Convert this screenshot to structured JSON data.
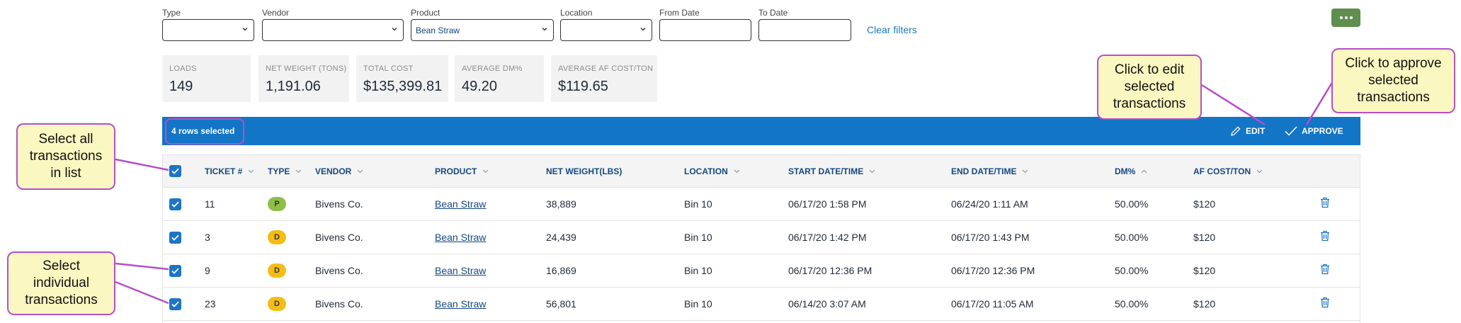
{
  "filters": {
    "type_label": "Type",
    "type_value": "",
    "vendor_label": "Vendor",
    "vendor_value": "",
    "product_label": "Product",
    "product_value": "Bean Straw",
    "location_label": "Location",
    "location_value": "",
    "from_date_label": "From Date",
    "from_date_value": "",
    "to_date_label": "To Date",
    "to_date_value": "",
    "clear_label": "Clear filters"
  },
  "more_button": {
    "icon": "more-dots-icon"
  },
  "stats": [
    {
      "label": "LOADS",
      "value": "149"
    },
    {
      "label": "NET WEIGHT (TONS)",
      "value": "1,191.06"
    },
    {
      "label": "TOTAL COST",
      "value": "$135,399.81"
    },
    {
      "label": "AVERAGE DM%",
      "value": "49.20"
    },
    {
      "label": "AVERAGE AF COST/TON",
      "value": "$119.65"
    }
  ],
  "selection_bar": {
    "count_text": "4 rows selected",
    "edit_label": "EDIT",
    "approve_label": "APPROVE",
    "color": "#1375c6"
  },
  "table": {
    "columns": [
      {
        "label": "TICKET #",
        "sort": "none"
      },
      {
        "label": "TYPE",
        "sort": "none"
      },
      {
        "label": "VENDOR",
        "sort": "none"
      },
      {
        "label": "PRODUCT",
        "sort": "none"
      },
      {
        "label": "NET WEIGHT(LBS)",
        "sort": "none"
      },
      {
        "label": "LOCATION",
        "sort": "none"
      },
      {
        "label": "START DATE/TIME",
        "sort": "none"
      },
      {
        "label": "END DATE/TIME",
        "sort": "none"
      },
      {
        "label": "DM%",
        "sort": "ascending"
      },
      {
        "label": "AF COST/TON",
        "sort": "none"
      }
    ],
    "rows": [
      {
        "ticket": "11",
        "type": "P",
        "vendor": "Bivens Co.",
        "product": "Bean Straw",
        "net_weight": "38,889",
        "location": "Bin 10",
        "start": "06/17/20 1:58 PM",
        "end": "06/24/20 1:11 AM",
        "dm": "50.00%",
        "af_cost": "$120",
        "selected": true
      },
      {
        "ticket": "3",
        "type": "D",
        "vendor": "Bivens Co.",
        "product": "Bean Straw",
        "net_weight": "24,439",
        "location": "Bin 10",
        "start": "06/17/20 1:42 PM",
        "end": "06/17/20 1:43 PM",
        "dm": "50.00%",
        "af_cost": "$120",
        "selected": true
      },
      {
        "ticket": "9",
        "type": "D",
        "vendor": "Bivens Co.",
        "product": "Bean Straw",
        "net_weight": "16,869",
        "location": "Bin 10",
        "start": "06/17/20 12:36 PM",
        "end": "06/17/20 12:36 PM",
        "dm": "50.00%",
        "af_cost": "$120",
        "selected": true
      },
      {
        "ticket": "23",
        "type": "D",
        "vendor": "Bivens Co.",
        "product": "Bean Straw",
        "net_weight": "56,801",
        "location": "Bin 10",
        "start": "06/14/20 3:07 AM",
        "end": "06/17/20 11:05 AM",
        "dm": "50.00%",
        "af_cost": "$120",
        "selected": true
      }
    ],
    "type_colors": {
      "P": "#8fbf48",
      "D": "#f4bd16"
    }
  },
  "callouts": {
    "select_all": "Select all transactions in list",
    "select_individual": "Select individual transactions",
    "edit": "Click to edit selected transactions",
    "approve": "Click to approve selected transactions",
    "color": "#b54fc8",
    "fill": "#fbf7c0"
  }
}
